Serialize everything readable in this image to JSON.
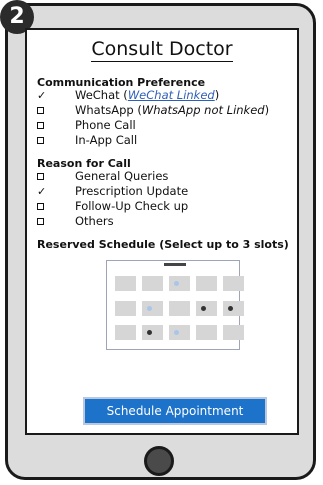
{
  "step_badge": "2",
  "title": "Consult Doctor",
  "communication": {
    "header": "Communication Preference",
    "options": [
      {
        "label": "WeChat",
        "checked": true,
        "note_link": "WeChat Linked"
      },
      {
        "label": "WhatsApp",
        "checked": false,
        "note": "WhatsApp not Linked"
      },
      {
        "label": "Phone Call",
        "checked": false
      },
      {
        "label": "In-App Call",
        "checked": false
      }
    ]
  },
  "reason": {
    "header": "Reason for Call",
    "options": [
      {
        "label": "General Queries",
        "checked": false
      },
      {
        "label": "Prescription Update",
        "checked": true
      },
      {
        "label": "Follow-Up Check up",
        "checked": false
      },
      {
        "label": "Others",
        "checked": false
      }
    ]
  },
  "schedule": {
    "header": "Reserved Schedule (Select up to 3 slots)",
    "rows": [
      [
        "empty",
        "empty",
        "light",
        "empty",
        "empty"
      ],
      [
        "empty",
        "light",
        "empty",
        "dark",
        "dark"
      ],
      [
        "empty",
        "dark",
        "light",
        "empty",
        "empty"
      ]
    ]
  },
  "action": {
    "button_label": "Schedule Appointment"
  },
  "colors": {
    "accent": "#1d72c9",
    "link": "#2f5fb5",
    "slot": "#d6d6d6"
  }
}
